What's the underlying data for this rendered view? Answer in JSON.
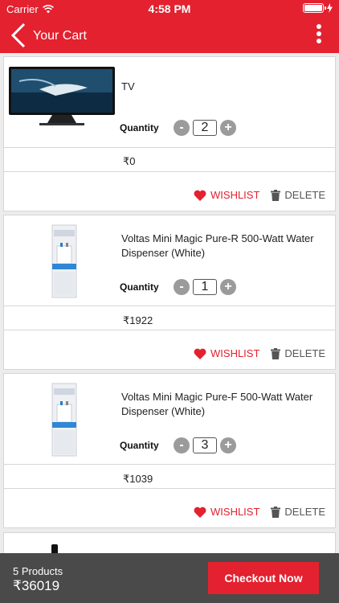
{
  "status": {
    "carrier": "Carrier",
    "time": "4:58 PM"
  },
  "header": {
    "title": "Your Cart"
  },
  "currency": "₹",
  "labels": {
    "quantity": "Quantity",
    "wishlist": "WISHLIST",
    "delete": "DELETE",
    "minus": "-",
    "plus": "+"
  },
  "items": [
    {
      "name": "TV",
      "quantity": "2",
      "price": "₹0",
      "image": "tv"
    },
    {
      "name": "Voltas Mini Magic Pure-R 500-Watt Water Dispenser (White)",
      "quantity": "1",
      "price": "₹1922",
      "image": "water-dispenser"
    },
    {
      "name": "Voltas Mini Magic Pure-F 500-Watt Water Dispenser (White)",
      "quantity": "3",
      "price": "₹1039",
      "image": "water-dispenser"
    }
  ],
  "footer": {
    "product_count": "5 Products",
    "total": "₹36019",
    "checkout_label": "Checkout Now"
  },
  "colors": {
    "accent": "#e3212f",
    "footer": "#4a4a4a"
  }
}
